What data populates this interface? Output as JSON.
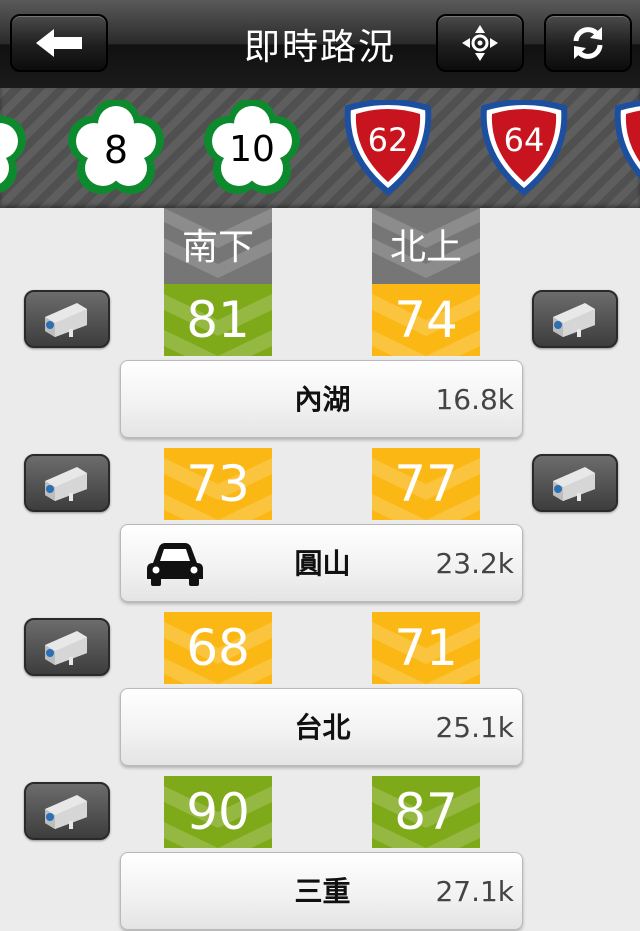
{
  "header": {
    "title": "即時路況",
    "back_icon": "back-arrow-icon",
    "locate_icon": "crosshair-icon",
    "refresh_icon": "refresh-icon"
  },
  "highways": [
    {
      "number": "",
      "type": "national"
    },
    {
      "number": "8",
      "type": "national"
    },
    {
      "number": "10",
      "type": "national"
    },
    {
      "number": "62",
      "type": "provincial"
    },
    {
      "number": "64",
      "type": "provincial"
    },
    {
      "number": "",
      "type": "provincial"
    }
  ],
  "directions": {
    "south": "南下",
    "north": "北上"
  },
  "speed_colors": {
    "green": "#7ea919",
    "yellow": "#fbb814"
  },
  "segments": [
    {
      "south": "81",
      "south_color": "green",
      "north": "74",
      "north_color": "yellow",
      "left_cam": true,
      "right_cam": true
    },
    {
      "south": "73",
      "south_color": "yellow",
      "north": "77",
      "north_color": "yellow",
      "left_cam": true,
      "right_cam": true
    },
    {
      "south": "68",
      "south_color": "yellow",
      "north": "71",
      "north_color": "yellow",
      "left_cam": true,
      "right_cam": false
    },
    {
      "south": "90",
      "south_color": "green",
      "north": "87",
      "north_color": "green",
      "left_cam": true,
      "right_cam": false
    }
  ],
  "stations": [
    {
      "name": "內湖",
      "distance": "16.8k",
      "car_icon": false
    },
    {
      "name": "圓山",
      "distance": "23.2k",
      "car_icon": true
    },
    {
      "name": "台北",
      "distance": "25.1k",
      "car_icon": false
    },
    {
      "name": "三重",
      "distance": "27.1k",
      "car_icon": false
    }
  ]
}
